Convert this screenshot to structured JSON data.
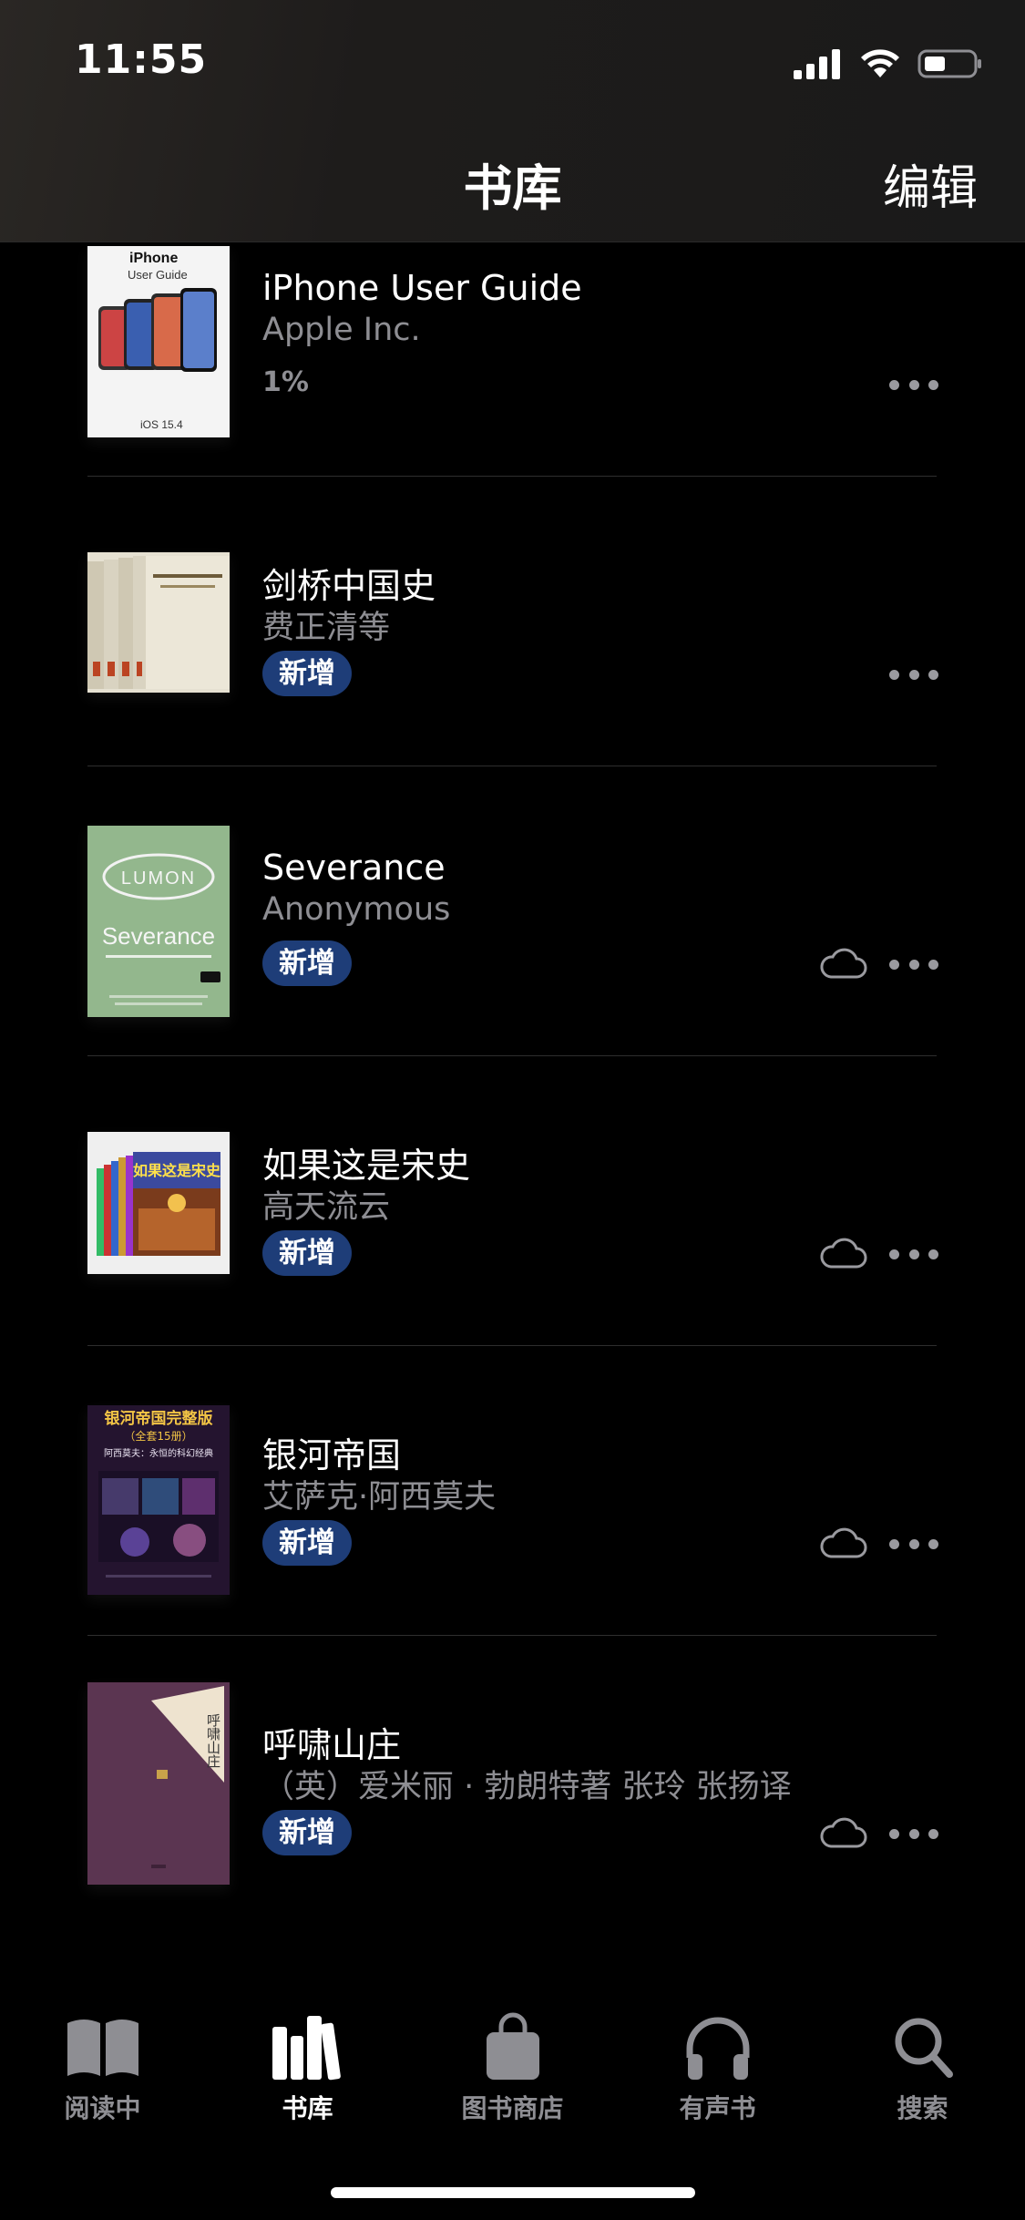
{
  "status_bar": {
    "time": "11:55",
    "icons": [
      "cellular-signal-icon",
      "wifi-icon",
      "battery-icon"
    ]
  },
  "nav": {
    "title": "书库",
    "edit_label": "编辑"
  },
  "books": [
    {
      "title": "iPhone User Guide",
      "author": "Apple Inc.",
      "progress": "1%",
      "badge": "",
      "cloud": false,
      "cover_text": {
        "brand": "iPhone",
        "subtitle": "User Guide",
        "footer": "iOS 15.4"
      }
    },
    {
      "title": "剑桥中国史",
      "author": "费正清等",
      "progress": "",
      "badge": "新增",
      "cloud": false
    },
    {
      "title": "Severance",
      "author": "Anonymous",
      "progress": "",
      "badge": "新增",
      "cloud": true,
      "cover_text": {
        "logo": "LUMON",
        "title": "Severance"
      }
    },
    {
      "title": "如果这是宋史",
      "author": "高天流云",
      "progress": "",
      "badge": "新增",
      "cloud": true,
      "cover_text": {
        "title": "如果这是宋史"
      }
    },
    {
      "title": "银河帝国",
      "author": "艾萨克·阿西莫夫",
      "progress": "",
      "badge": "新增",
      "cloud": true,
      "cover_text": {
        "title": "银河帝国完整版",
        "sub": "（全套15册）",
        "tagline": "阿西莫夫：永恒的科幻经典"
      }
    },
    {
      "title": "呼啸山庄",
      "author": "（英）爱米丽 · 勃朗特著 张玲 张扬译",
      "progress": "",
      "badge": "新增",
      "cloud": true,
      "cover_text": {
        "title": "呼啸山庄"
      }
    }
  ],
  "tabs": [
    {
      "label": "阅读中",
      "icon": "book-open-icon",
      "active": false
    },
    {
      "label": "书库",
      "icon": "library-books-icon",
      "active": true
    },
    {
      "label": "图书商店",
      "icon": "shopping-bag-icon",
      "active": false
    },
    {
      "label": "有声书",
      "icon": "headphones-icon",
      "active": false
    },
    {
      "label": "搜索",
      "icon": "search-icon",
      "active": false
    }
  ],
  "colors": {
    "background": "#000000",
    "badge": "#1e3d78",
    "secondary_text": "#8e8e93"
  }
}
